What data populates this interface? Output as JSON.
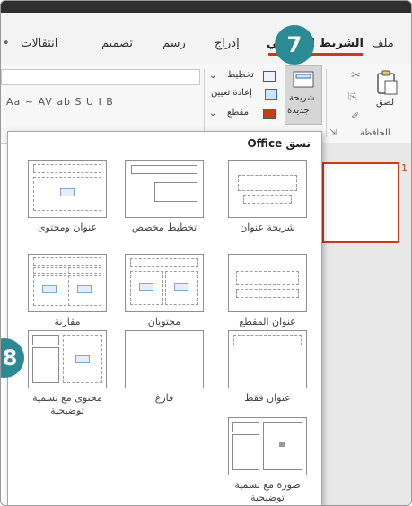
{
  "tabs": {
    "file": "ملف",
    "home": "الشريط الرئيسي",
    "insert": "إدراج",
    "draw": "رسم",
    "design": "تصميم",
    "transitions": "انتقالات"
  },
  "ribbon": {
    "paste_label": "لصق",
    "clipboard_group": "الحافظة",
    "new_slide_line1": "شريحة",
    "new_slide_line2": "جديدة",
    "layout_label": "تخطيط",
    "reset_label": "إعادة تعيين",
    "section_label": "مقطع",
    "font_controls": "Aa ~ AV ab S U I B"
  },
  "panel": {
    "title": "نسق Office",
    "layouts": [
      {
        "label": "شريحة عنوان",
        "kind": "title-slide"
      },
      {
        "label": "تخطيط مخصص",
        "kind": "custom"
      },
      {
        "label": "عنوان ومحتوى",
        "kind": "title-content"
      },
      {
        "label": "عنوان المقطع",
        "kind": "section-header"
      },
      {
        "label": "محتويان",
        "kind": "two-content"
      },
      {
        "label": "مقارنة",
        "kind": "comparison"
      },
      {
        "label": "عنوان فقط",
        "kind": "title-only"
      },
      {
        "label": "فارغ",
        "kind": "blank"
      },
      {
        "label": "محتوى مع تسمية توضيحية",
        "kind": "content-caption"
      },
      {
        "label": "صورة مع تسمية توضيحية",
        "kind": "picture-caption"
      }
    ]
  },
  "slides": {
    "first_number": "1"
  },
  "badges": {
    "new_slide_step": "7",
    "layout_step": "8"
  },
  "colors": {
    "accent": "#c43e1c",
    "badge": "#2c8a94"
  }
}
